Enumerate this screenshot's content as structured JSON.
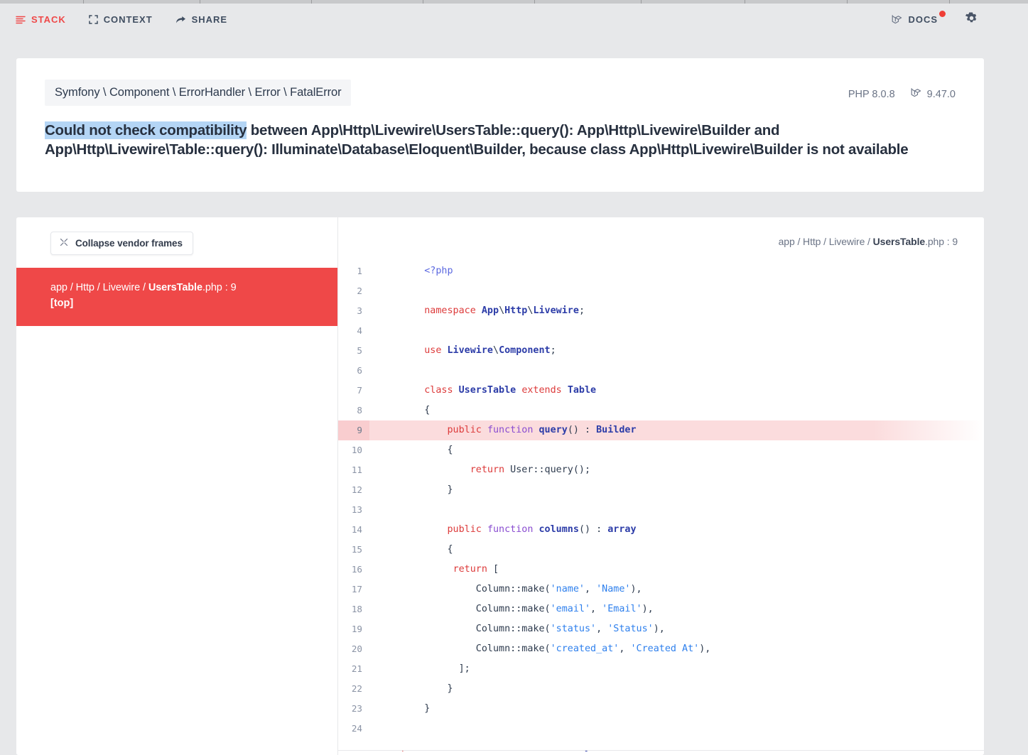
{
  "topbar": {
    "left_items": [
      {
        "label": "STACK",
        "icon": "stack-lines-icon",
        "active": true
      },
      {
        "label": "CONTEXT",
        "icon": "crop-brackets-icon",
        "active": false
      },
      {
        "label": "SHARE",
        "icon": "share-arrow-icon",
        "active": false
      }
    ],
    "docs_label": "DOCS",
    "docs_icon": "laravel-logo-icon",
    "docs_has_notification": true,
    "settings_icon": "gear-icon",
    "accent_color": "#ef4848"
  },
  "exception": {
    "class_name": "Symfony \\ Component \\ ErrorHandler \\ Error \\ FatalError",
    "message_selected": "Could not check compatibility",
    "message_rest_line1": " between App\\Http\\Livewire\\UsersTable::query(): App\\Http\\Livewire\\Builder and",
    "message_rest_line2": "App\\Http\\Livewire\\Table::query(): Illuminate\\Database\\Eloquent\\Builder, because class App\\Http\\Livewire\\Builder is not available",
    "php_version": "PHP 8.0.8",
    "framework_version": "9.47.0",
    "framework_icon": "laravel-logo-icon"
  },
  "frames": {
    "collapse_button_label": "Collapse vendor frames",
    "collapse_button_icon": "collapse-arrows-icon",
    "items": [
      {
        "path_prefix": "app / Http / Livewire / ",
        "file_name": "UsersTable",
        "file_ext": ".php",
        "line_sep": " : ",
        "line": "9",
        "tag": "[top]",
        "selected": true
      }
    ]
  },
  "code": {
    "file_path_prefix": "app / Http / Livewire / ",
    "file_path_name": "UsersTable",
    "file_path_ext": ".php",
    "file_path_sep": " : ",
    "file_path_line": "9",
    "highlight_line": 9,
    "lines": [
      {
        "n": "1",
        "tokens": [
          {
            "t": "pln",
            "v": "    "
          },
          {
            "t": "tag",
            "v": "<?php"
          }
        ]
      },
      {
        "n": "2",
        "tokens": []
      },
      {
        "n": "3",
        "tokens": [
          {
            "t": "pln",
            "v": "    "
          },
          {
            "t": "kw",
            "v": "namespace"
          },
          {
            "t": "pln",
            "v": " "
          },
          {
            "t": "cls",
            "v": "App"
          },
          {
            "t": "pln",
            "v": "\\"
          },
          {
            "t": "cls",
            "v": "Http"
          },
          {
            "t": "pln",
            "v": "\\"
          },
          {
            "t": "cls",
            "v": "Livewire"
          },
          {
            "t": "pln",
            "v": ";"
          }
        ]
      },
      {
        "n": "4",
        "tokens": []
      },
      {
        "n": "5",
        "tokens": [
          {
            "t": "pln",
            "v": "    "
          },
          {
            "t": "kw",
            "v": "use"
          },
          {
            "t": "pln",
            "v": " "
          },
          {
            "t": "cls",
            "v": "Livewire"
          },
          {
            "t": "pln",
            "v": "\\"
          },
          {
            "t": "cls",
            "v": "Component"
          },
          {
            "t": "pln",
            "v": ";"
          }
        ]
      },
      {
        "n": "6",
        "tokens": []
      },
      {
        "n": "7",
        "tokens": [
          {
            "t": "pln",
            "v": "    "
          },
          {
            "t": "kw",
            "v": "class"
          },
          {
            "t": "pln",
            "v": " "
          },
          {
            "t": "cls",
            "v": "UsersTable"
          },
          {
            "t": "pln",
            "v": " "
          },
          {
            "t": "kw",
            "v": "extends"
          },
          {
            "t": "pln",
            "v": " "
          },
          {
            "t": "cls",
            "v": "Table"
          }
        ]
      },
      {
        "n": "8",
        "tokens": [
          {
            "t": "pln",
            "v": "    {"
          }
        ]
      },
      {
        "n": "9",
        "tokens": [
          {
            "t": "pln",
            "v": "        "
          },
          {
            "t": "kw",
            "v": "public"
          },
          {
            "t": "pln",
            "v": " "
          },
          {
            "t": "fn",
            "v": "function"
          },
          {
            "t": "pln",
            "v": " "
          },
          {
            "t": "name",
            "v": "query"
          },
          {
            "t": "pln",
            "v": "() : "
          },
          {
            "t": "cls",
            "v": "Builder"
          }
        ]
      },
      {
        "n": "10",
        "tokens": [
          {
            "t": "pln",
            "v": "        {"
          }
        ]
      },
      {
        "n": "11",
        "tokens": [
          {
            "t": "pln",
            "v": "            "
          },
          {
            "t": "kw",
            "v": "return"
          },
          {
            "t": "pln",
            "v": " User::query();"
          }
        ]
      },
      {
        "n": "12",
        "tokens": [
          {
            "t": "pln",
            "v": "        }"
          }
        ]
      },
      {
        "n": "13",
        "tokens": []
      },
      {
        "n": "14",
        "tokens": [
          {
            "t": "pln",
            "v": "        "
          },
          {
            "t": "kw",
            "v": "public"
          },
          {
            "t": "pln",
            "v": " "
          },
          {
            "t": "fn",
            "v": "function"
          },
          {
            "t": "pln",
            "v": " "
          },
          {
            "t": "name",
            "v": "columns"
          },
          {
            "t": "pln",
            "v": "() : "
          },
          {
            "t": "cls",
            "v": "array"
          }
        ]
      },
      {
        "n": "15",
        "tokens": [
          {
            "t": "pln",
            "v": "        {"
          }
        ]
      },
      {
        "n": "16",
        "tokens": [
          {
            "t": "pln",
            "v": "         "
          },
          {
            "t": "kw",
            "v": "return"
          },
          {
            "t": "pln",
            "v": " ["
          }
        ]
      },
      {
        "n": "17",
        "tokens": [
          {
            "t": "pln",
            "v": "             Column::make("
          },
          {
            "t": "str",
            "v": "'name'"
          },
          {
            "t": "pln",
            "v": ", "
          },
          {
            "t": "str",
            "v": "'Name'"
          },
          {
            "t": "pln",
            "v": "),"
          }
        ]
      },
      {
        "n": "18",
        "tokens": [
          {
            "t": "pln",
            "v": "             Column::make("
          },
          {
            "t": "str",
            "v": "'email'"
          },
          {
            "t": "pln",
            "v": ", "
          },
          {
            "t": "str",
            "v": "'Email'"
          },
          {
            "t": "pln",
            "v": "),"
          }
        ]
      },
      {
        "n": "19",
        "tokens": [
          {
            "t": "pln",
            "v": "             Column::make("
          },
          {
            "t": "str",
            "v": "'status'"
          },
          {
            "t": "pln",
            "v": ", "
          },
          {
            "t": "str",
            "v": "'Status'"
          },
          {
            "t": "pln",
            "v": "),"
          }
        ]
      },
      {
        "n": "20",
        "tokens": [
          {
            "t": "pln",
            "v": "             Column::make("
          },
          {
            "t": "str",
            "v": "'created_at'"
          },
          {
            "t": "pln",
            "v": ", "
          },
          {
            "t": "str",
            "v": "'Created At'"
          },
          {
            "t": "pln",
            "v": "),"
          }
        ]
      },
      {
        "n": "21",
        "tokens": [
          {
            "t": "pln",
            "v": "          ];"
          }
        ]
      },
      {
        "n": "22",
        "tokens": [
          {
            "t": "pln",
            "v": "        }"
          }
        ]
      },
      {
        "n": "23",
        "tokens": [
          {
            "t": "pln",
            "v": "    }"
          }
        ]
      },
      {
        "n": "24",
        "tokens": []
      }
    ]
  }
}
